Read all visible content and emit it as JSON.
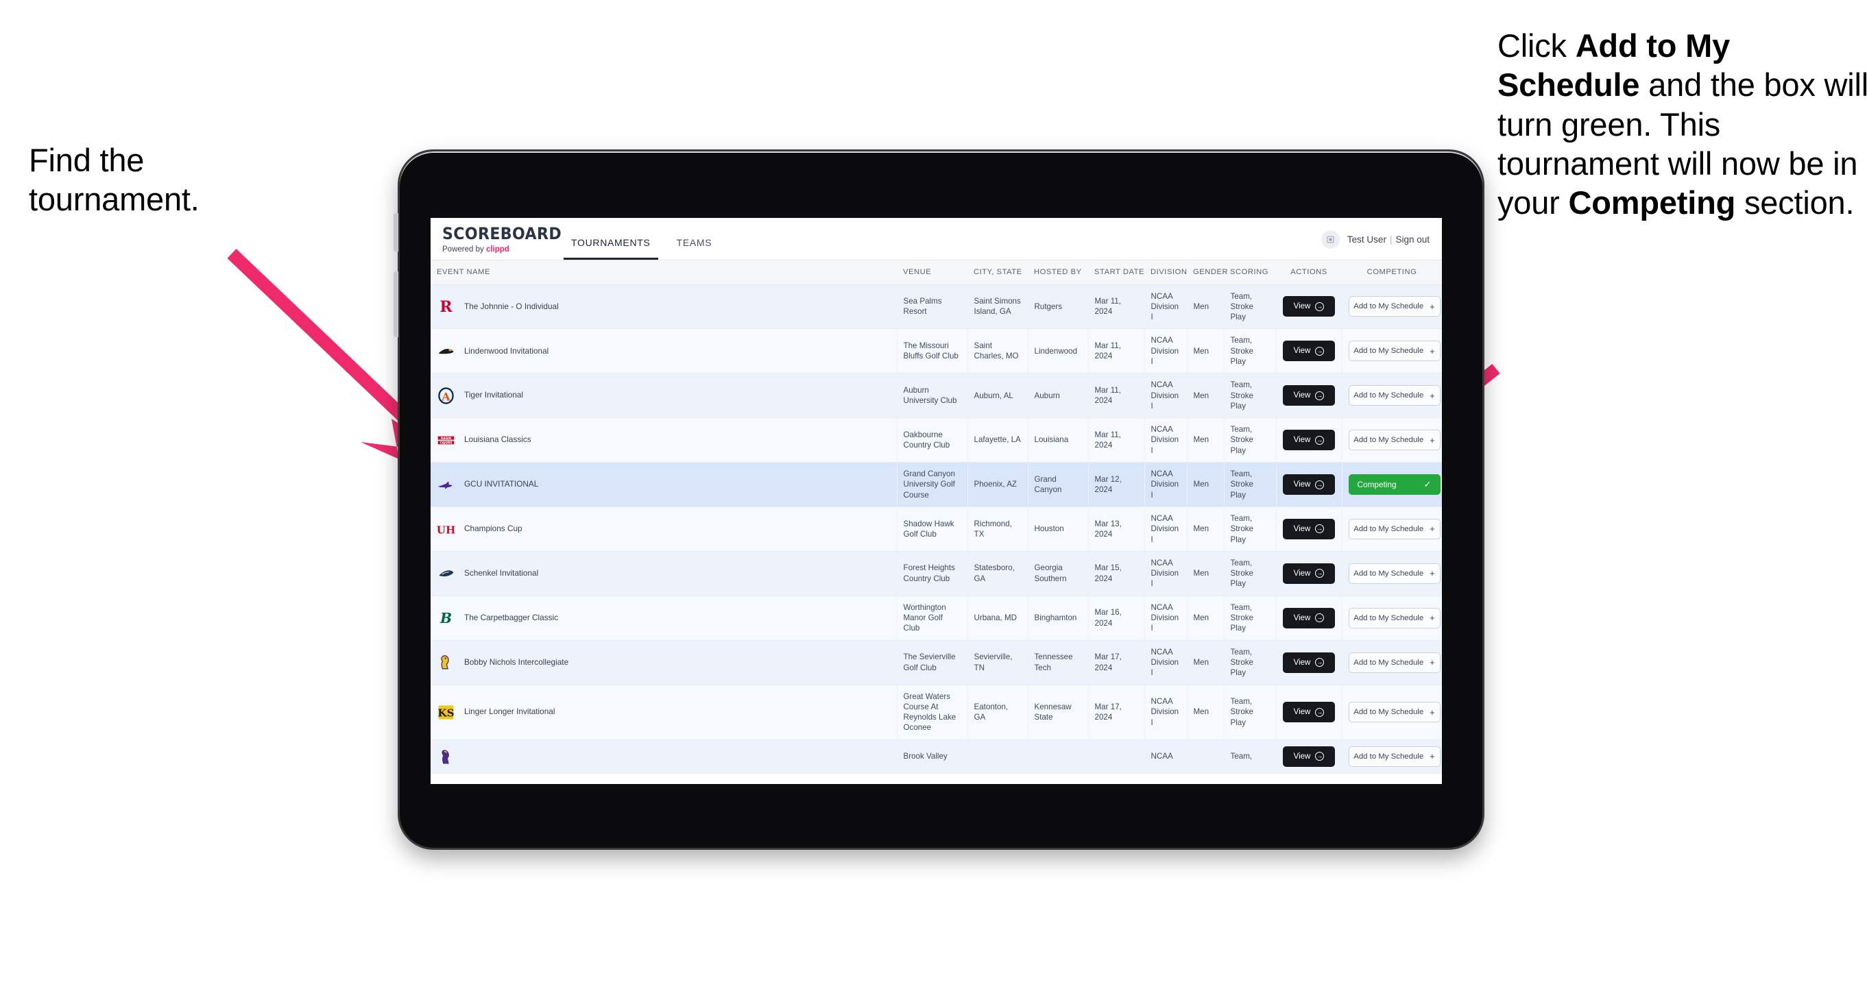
{
  "callouts": {
    "left": {
      "line1": "Find the",
      "line2": "tournament."
    },
    "right": {
      "seg1": "Click ",
      "bold1": "Add to My Schedule",
      "seg2": " and the box will turn green. This tournament will now be in your ",
      "bold2": "Competing",
      "seg3": " section."
    }
  },
  "arrow_color": "#ef2a6b",
  "app": {
    "brand": {
      "title": "SCOREBOARD",
      "powered_prefix": "Powered by ",
      "powered_brand": "clippd",
      "brand_accent": "#f3246b"
    },
    "tabs": [
      {
        "label": "TOURNAMENTS",
        "active": true
      },
      {
        "label": "TEAMS",
        "active": false
      }
    ],
    "account": {
      "avatar_icon": "user-badge-icon",
      "user": "Test User",
      "separator": "|",
      "sign_out": "Sign out"
    }
  },
  "table": {
    "columns": [
      "EVENT NAME",
      "VENUE",
      "CITY, STATE",
      "HOSTED BY",
      "START DATE",
      "DIVISION",
      "GENDER",
      "SCORING",
      "ACTIONS",
      "COMPETING"
    ],
    "action_label": "View",
    "add_label": "Add to My Schedule",
    "add_icon": "plus-icon",
    "competing_label": "Competing",
    "competing_icon": "check-icon",
    "competing_color": "#23a73e",
    "rows": [
      {
        "event": "The Johnnie - O Individual",
        "logo": "rutgers-logo",
        "venue": "Sea Palms Resort",
        "city": "Saint Simons Island, GA",
        "host": "Rutgers",
        "date": "Mar 11, 2024",
        "division": "NCAA Division I",
        "gender": "Men",
        "scoring": "Team, Stroke Play",
        "competing": false,
        "selected": false
      },
      {
        "event": "Lindenwood Invitational",
        "logo": "lindenwood-logo",
        "venue": "The Missouri Bluffs Golf Club",
        "city": "Saint Charles, MO",
        "host": "Lindenwood",
        "date": "Mar 11, 2024",
        "division": "NCAA Division I",
        "gender": "Men",
        "scoring": "Team, Stroke Play",
        "competing": false,
        "selected": false
      },
      {
        "event": "Tiger Invitational",
        "logo": "auburn-logo",
        "venue": "Auburn University Club",
        "city": "Auburn, AL",
        "host": "Auburn",
        "date": "Mar 11, 2024",
        "division": "NCAA Division I",
        "gender": "Men",
        "scoring": "Team, Stroke Play",
        "competing": false,
        "selected": false
      },
      {
        "event": "Louisiana Classics",
        "logo": "louisiana-logo",
        "venue": "Oakbourne Country Club",
        "city": "Lafayette, LA",
        "host": "Louisiana",
        "date": "Mar 11, 2024",
        "division": "NCAA Division I",
        "gender": "Men",
        "scoring": "Team, Stroke Play",
        "competing": false,
        "selected": false
      },
      {
        "event": "GCU INVITATIONAL",
        "logo": "grand-canyon-logo",
        "venue": "Grand Canyon University Golf Course",
        "city": "Phoenix, AZ",
        "host": "Grand Canyon",
        "date": "Mar 12, 2024",
        "division": "NCAA Division I",
        "gender": "Men",
        "scoring": "Team, Stroke Play",
        "competing": true,
        "selected": true
      },
      {
        "event": "Champions Cup",
        "logo": "houston-logo",
        "venue": "Shadow Hawk Golf Club",
        "city": "Richmond, TX",
        "host": "Houston",
        "date": "Mar 13, 2024",
        "division": "NCAA Division I",
        "gender": "Men",
        "scoring": "Team, Stroke Play",
        "competing": false,
        "selected": false
      },
      {
        "event": "Schenkel Invitational",
        "logo": "georgia-southern-logo",
        "venue": "Forest Heights Country Club",
        "city": "Statesboro, GA",
        "host": "Georgia Southern",
        "date": "Mar 15, 2024",
        "division": "NCAA Division I",
        "gender": "Men",
        "scoring": "Team, Stroke Play",
        "competing": false,
        "selected": false
      },
      {
        "event": "The Carpetbagger Classic",
        "logo": "binghamton-logo",
        "venue": "Worthington Manor Golf Club",
        "city": "Urbana, MD",
        "host": "Binghamton",
        "date": "Mar 16, 2024",
        "division": "NCAA Division I",
        "gender": "Men",
        "scoring": "Team, Stroke Play",
        "competing": false,
        "selected": false
      },
      {
        "event": "Bobby Nichols Intercollegiate",
        "logo": "tennessee-tech-logo",
        "venue": "The Sevierville Golf Club",
        "city": "Sevierville, TN",
        "host": "Tennessee Tech",
        "date": "Mar 17, 2024",
        "division": "NCAA Division I",
        "gender": "Men",
        "scoring": "Team, Stroke Play",
        "competing": false,
        "selected": false
      },
      {
        "event": "Linger Longer Invitational",
        "logo": "kennesaw-state-logo",
        "venue": "Great Waters Course At Reynolds Lake Oconee",
        "city": "Eatonton, GA",
        "host": "Kennesaw State",
        "date": "Mar 17, 2024",
        "division": "NCAA Division I",
        "gender": "Men",
        "scoring": "Team, Stroke Play",
        "competing": false,
        "selected": false
      },
      {
        "event": "",
        "logo": "east-carolina-logo",
        "venue": "Brook Valley",
        "city": "",
        "host": "",
        "date": "",
        "division": "NCAA",
        "gender": "",
        "scoring": "Team,",
        "competing": false,
        "selected": false
      }
    ]
  }
}
